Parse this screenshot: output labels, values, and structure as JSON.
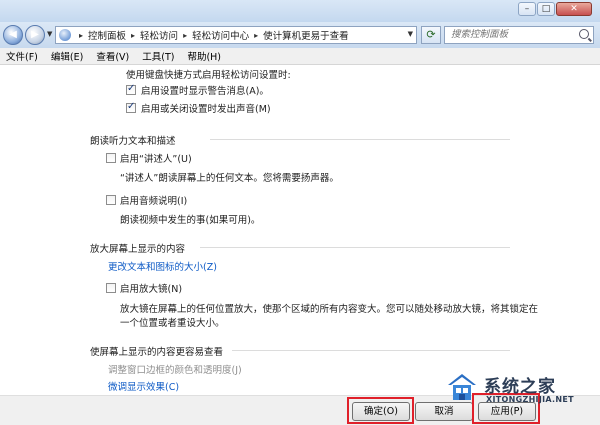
{
  "address": {
    "crumbs": [
      "控制面板",
      "轻松访问",
      "轻松访问中心",
      "使计算机更易于查看"
    ],
    "search_placeholder": "搜索控制面板"
  },
  "menu": [
    "文件(F)",
    "编辑(E)",
    "查看(V)",
    "工具(T)",
    "帮助(H)"
  ],
  "top_section": {
    "partial_text": "使用键盘快捷方式启用轻松访问设置时:",
    "options": [
      {
        "label": "启用设置时显示警告消息(A)。",
        "checked": true
      },
      {
        "label": "启用或关闭设置时发出声音(M)",
        "checked": true
      }
    ]
  },
  "narrator_section": {
    "heading": "朗读听力文本和描述",
    "narrator_label": "启用“讲述人”(U)",
    "narrator_desc": "“讲述人”朗读屏幕上的任何文本。您将需要扬声器。",
    "audio_label": "启用音频说明(I)",
    "audio_desc": "朗读视频中发生的事(如果可用)。"
  },
  "magnify_section": {
    "heading": "放大屏幕上显示的内容",
    "link": "更改文本和图标的大小(Z)",
    "magnifier_label": "启用放大镜(N)",
    "magnifier_desc_1": "放大镜在屏幕上的任何位置放大，使那个区域的所有内容变大。您可以随处移动放大镜，将其锁定在",
    "magnifier_desc_2": "一个位置或者重设大小。"
  },
  "easier_section": {
    "heading": "使屏幕上显示的内容更容易查看",
    "link_1": "调整窗口边框的颜色和透明度(J)",
    "link_2": "微调显示效果(C)"
  },
  "buttons": {
    "ok": "确定(O)",
    "cancel": "取消",
    "apply": "应用(P)"
  },
  "watermark": {
    "name": "系统之家",
    "domain": "XITONGZHIJIA.NET"
  }
}
